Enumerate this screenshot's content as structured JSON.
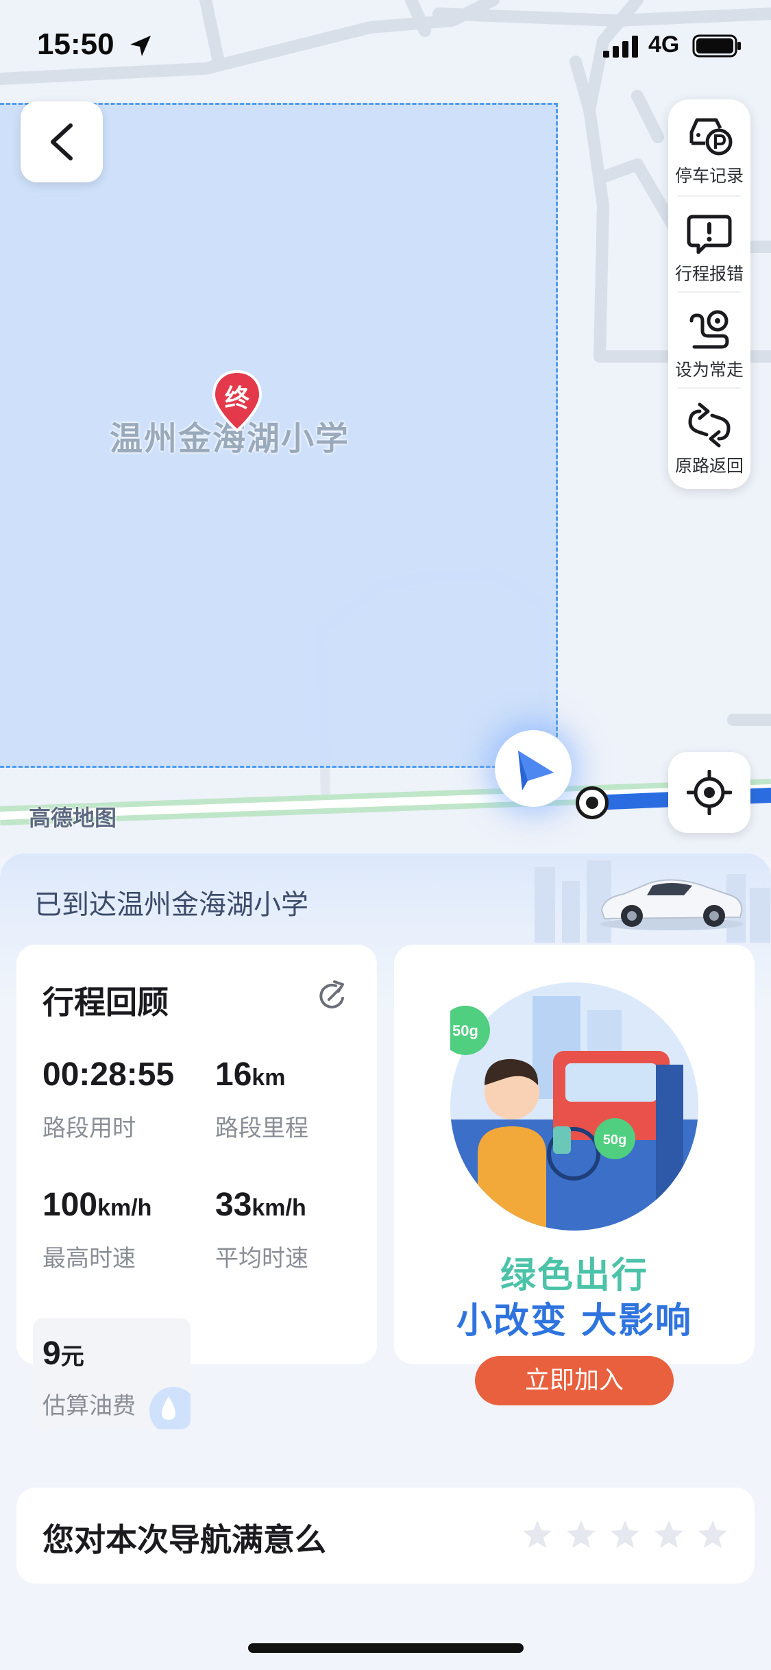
{
  "status_bar": {
    "time": "15:50",
    "network": "4G"
  },
  "map": {
    "destination_name": "温州金海湖小学",
    "pin_label": "终",
    "brand": "高德地图"
  },
  "tools": [
    {
      "label": "停车记录",
      "icon": "parking-car-icon"
    },
    {
      "label": "行程报错",
      "icon": "report-error-icon"
    },
    {
      "label": "设为常走",
      "icon": "route-pin-icon"
    },
    {
      "label": "原路返回",
      "icon": "return-loop-icon"
    }
  ],
  "sheet": {
    "arrived_text": "已到达温州金海湖小学",
    "trip": {
      "title": "行程回顾",
      "duration": {
        "value": "00:28:55",
        "label": "路段用时"
      },
      "distance": {
        "value": "16",
        "unit": "km",
        "label": "路段里程"
      },
      "max_speed": {
        "value": "100",
        "unit": "km/h",
        "label": "最高时速"
      },
      "avg_speed": {
        "value": "33",
        "unit": "km/h",
        "label": "平均时速"
      },
      "fuel": {
        "value": "9",
        "unit": "元",
        "label": "估算油费"
      }
    },
    "green": {
      "badge_large": "50g",
      "badge_small": "50g",
      "slogan_line1": "绿色出行",
      "slogan_line2": "小改变 大影响",
      "join_label": "立即加入"
    },
    "rating": {
      "question": "您对本次导航满意么",
      "stars_total": 5,
      "stars_selected": 0
    }
  },
  "colors": {
    "accent_blue": "#2f74de",
    "accent_green": "#4cc3a8",
    "join_button": "#e9603e",
    "area_fill": "#cbdefa",
    "area_border": "#4d9cf0"
  }
}
